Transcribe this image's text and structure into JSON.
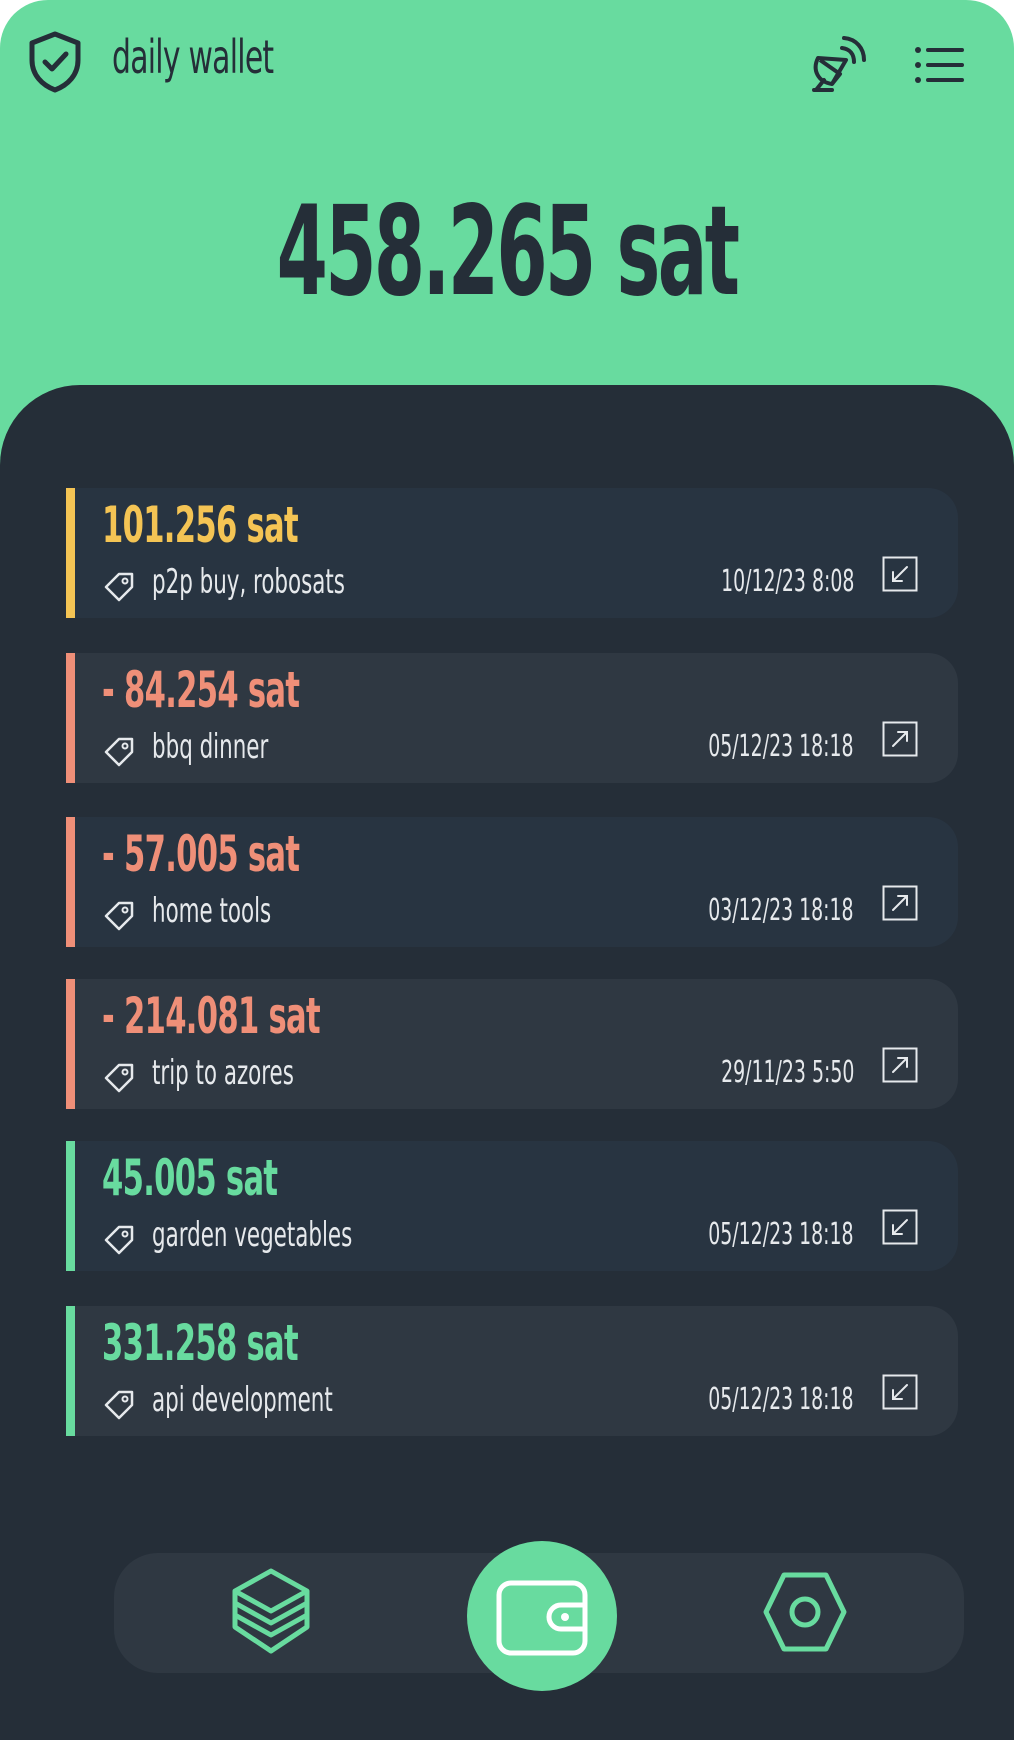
{
  "header": {
    "title": "daily wallet"
  },
  "balance": {
    "text": "458.265 sat"
  },
  "transactions": [
    {
      "amount": "101.256 sat",
      "note": "p2p buy, robosats",
      "date": "10/12/23 8:08",
      "direction": "incoming",
      "accent": "#f4c454"
    },
    {
      "amount": "- 84.254 sat",
      "note": "bbq dinner",
      "date": "05/12/23 18:18",
      "direction": "outgoing",
      "accent": "#ef8f78"
    },
    {
      "amount": "- 57.005 sat",
      "note": "home tools",
      "date": "03/12/23 18:18",
      "direction": "outgoing",
      "accent": "#ef8f78"
    },
    {
      "amount": "- 214.081 sat",
      "note": "trip to azores",
      "date": "29/11/23 5:50",
      "direction": "outgoing",
      "accent": "#ef8f78"
    },
    {
      "amount": "45.005 sat",
      "note": "garden vegetables",
      "date": "05/12/23 18:18",
      "direction": "incoming",
      "accent": "#68db9f"
    },
    {
      "amount": "331.258 sat",
      "note": "api development",
      "date": "05/12/23 18:18",
      "direction": "incoming",
      "accent": "#68db9f"
    }
  ],
  "nav": {
    "items": [
      "layers-icon",
      "wallet-icon",
      "settings-icon"
    ],
    "active": "wallet-icon"
  },
  "colors": {
    "brand": "#68db9f",
    "dark": "#252e38",
    "incoming_yellow": "#f4c454",
    "outgoing": "#ef8f78",
    "incoming_green": "#68db9f"
  }
}
